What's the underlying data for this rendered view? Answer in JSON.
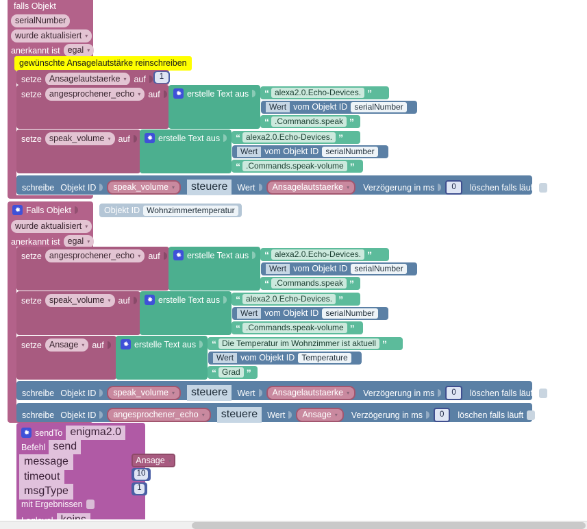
{
  "app": {
    "type": "blockly-visual-script-editor",
    "language": "de"
  },
  "colors": {
    "event_block": "#b3628a",
    "text_block": "#4caf8f",
    "control_block": "#5b80a5",
    "number_block": "#4a5fa5",
    "objectid_block": "#b4c6d6",
    "sendto_block": "#b05aa5",
    "comment_highlight": "#ffff00",
    "canvas_bg": "#ffffff",
    "grid_dot": "#e8e4e4"
  },
  "blocks": {
    "trigger1": {
      "title": "falls Objekt",
      "object_id": "serialNumber",
      "condition_label": "wurde aktualisiert",
      "ack_label": "anerkannt ist",
      "ack_value": "egal"
    },
    "comment1": "gewünschte Ansagelautstärke reinschreiben",
    "set_volume_var": {
      "keyword": "setze",
      "variable": "Ansagelautstaerke",
      "connector": "auf",
      "value": "1"
    },
    "set_echo1": {
      "keyword": "setze",
      "variable": "angesprochener_echo",
      "connector": "auf",
      "join_label": "erstelle Text aus",
      "parts": [
        {
          "kind": "text",
          "value": "alexa2.0.Echo-Devices."
        },
        {
          "kind": "getvalue",
          "attr": "Wert",
          "label": "vom Objekt ID",
          "object": "serialNumber"
        },
        {
          "kind": "text",
          "value": ".Commands.speak"
        }
      ]
    },
    "set_speakvol1": {
      "keyword": "setze",
      "variable": "speak_volume",
      "connector": "auf",
      "join_label": "erstelle Text aus",
      "parts": [
        {
          "kind": "text",
          "value": "alexa2.0.Echo-Devices."
        },
        {
          "kind": "getvalue",
          "attr": "Wert",
          "label": "vom Objekt ID",
          "object": "serialNumber"
        },
        {
          "kind": "text",
          "value": ".Commands.speak-volume"
        }
      ]
    },
    "write1": {
      "keyword": "schreibe",
      "objid_label": "Objekt ID",
      "objid_value": "speak_volume",
      "mode": "steuere",
      "value_label": "Wert",
      "value_variable": "Ansagelautstaerke",
      "delay_label": "Verzögerung in ms",
      "delay_value": "0",
      "clear_label": "löschen falls läuft",
      "clear_checked": false
    },
    "trigger2": {
      "title": "Falls Objekt",
      "objid_label": "Objekt ID",
      "objid_value": "Wohnzimmertemperatur",
      "condition_label": "wurde aktualisiert",
      "ack_label": "anerkannt ist",
      "ack_value": "egal"
    },
    "set_echo2": {
      "keyword": "setze",
      "variable": "angesprochener_echo",
      "connector": "auf",
      "join_label": "erstelle Text aus",
      "parts": [
        {
          "kind": "text",
          "value": "alexa2.0.Echo-Devices."
        },
        {
          "kind": "getvalue",
          "attr": "Wert",
          "label": "vom Objekt ID",
          "object": "serialNumber"
        },
        {
          "kind": "text",
          "value": ".Commands.speak"
        }
      ]
    },
    "set_speakvol2": {
      "keyword": "setze",
      "variable": "speak_volume",
      "connector": "auf",
      "join_label": "erstelle Text aus",
      "parts": [
        {
          "kind": "text",
          "value": "alexa2.0.Echo-Devices."
        },
        {
          "kind": "getvalue",
          "attr": "Wert",
          "label": "vom Objekt ID",
          "object": "serialNumber"
        },
        {
          "kind": "text",
          "value": ".Commands.speak-volume"
        }
      ]
    },
    "set_ansage": {
      "keyword": "setze",
      "variable": "Ansage",
      "connector": "auf",
      "join_label": "erstelle Text aus",
      "parts": [
        {
          "kind": "text",
          "value": "Die Temperatur im Wohnzimmer ist aktuell"
        },
        {
          "kind": "getvalue",
          "attr": "Wert",
          "label": "vom Objekt ID",
          "object": "Temperature"
        },
        {
          "kind": "text",
          "value": "Grad"
        }
      ]
    },
    "write2": {
      "keyword": "schreibe",
      "objid_label": "Objekt ID",
      "objid_value": "speak_volume",
      "mode": "steuere",
      "value_label": "Wert",
      "value_variable": "Ansagelautstaerke",
      "delay_label": "Verzögerung in ms",
      "delay_value": "0",
      "clear_label": "löschen falls läuft",
      "clear_checked": false
    },
    "write3": {
      "keyword": "schreibe",
      "objid_label": "Objekt ID",
      "objid_value": "angesprochener_echo",
      "mode": "steuere",
      "value_label": "Wert",
      "value_variable": "Ansage",
      "delay_label": "Verzögerung in ms",
      "delay_value": "0",
      "clear_label": "löschen falls läuft",
      "clear_checked": false
    },
    "sendto": {
      "title": "sendTo",
      "instance": "enigma2.0",
      "command_label": "Befehl",
      "command_value": "send",
      "message_label": "message",
      "message_value": "Ansage",
      "timeout_label": "timeout",
      "timeout_value": "10",
      "msgtype_label": "msgType",
      "msgtype_value": "1",
      "results_label": "mit Ergebnissen",
      "results_checked": false,
      "loglevel_label": "Loglevel",
      "loglevel_value": "keins"
    }
  },
  "icons": {
    "gear": "gear-icon"
  }
}
